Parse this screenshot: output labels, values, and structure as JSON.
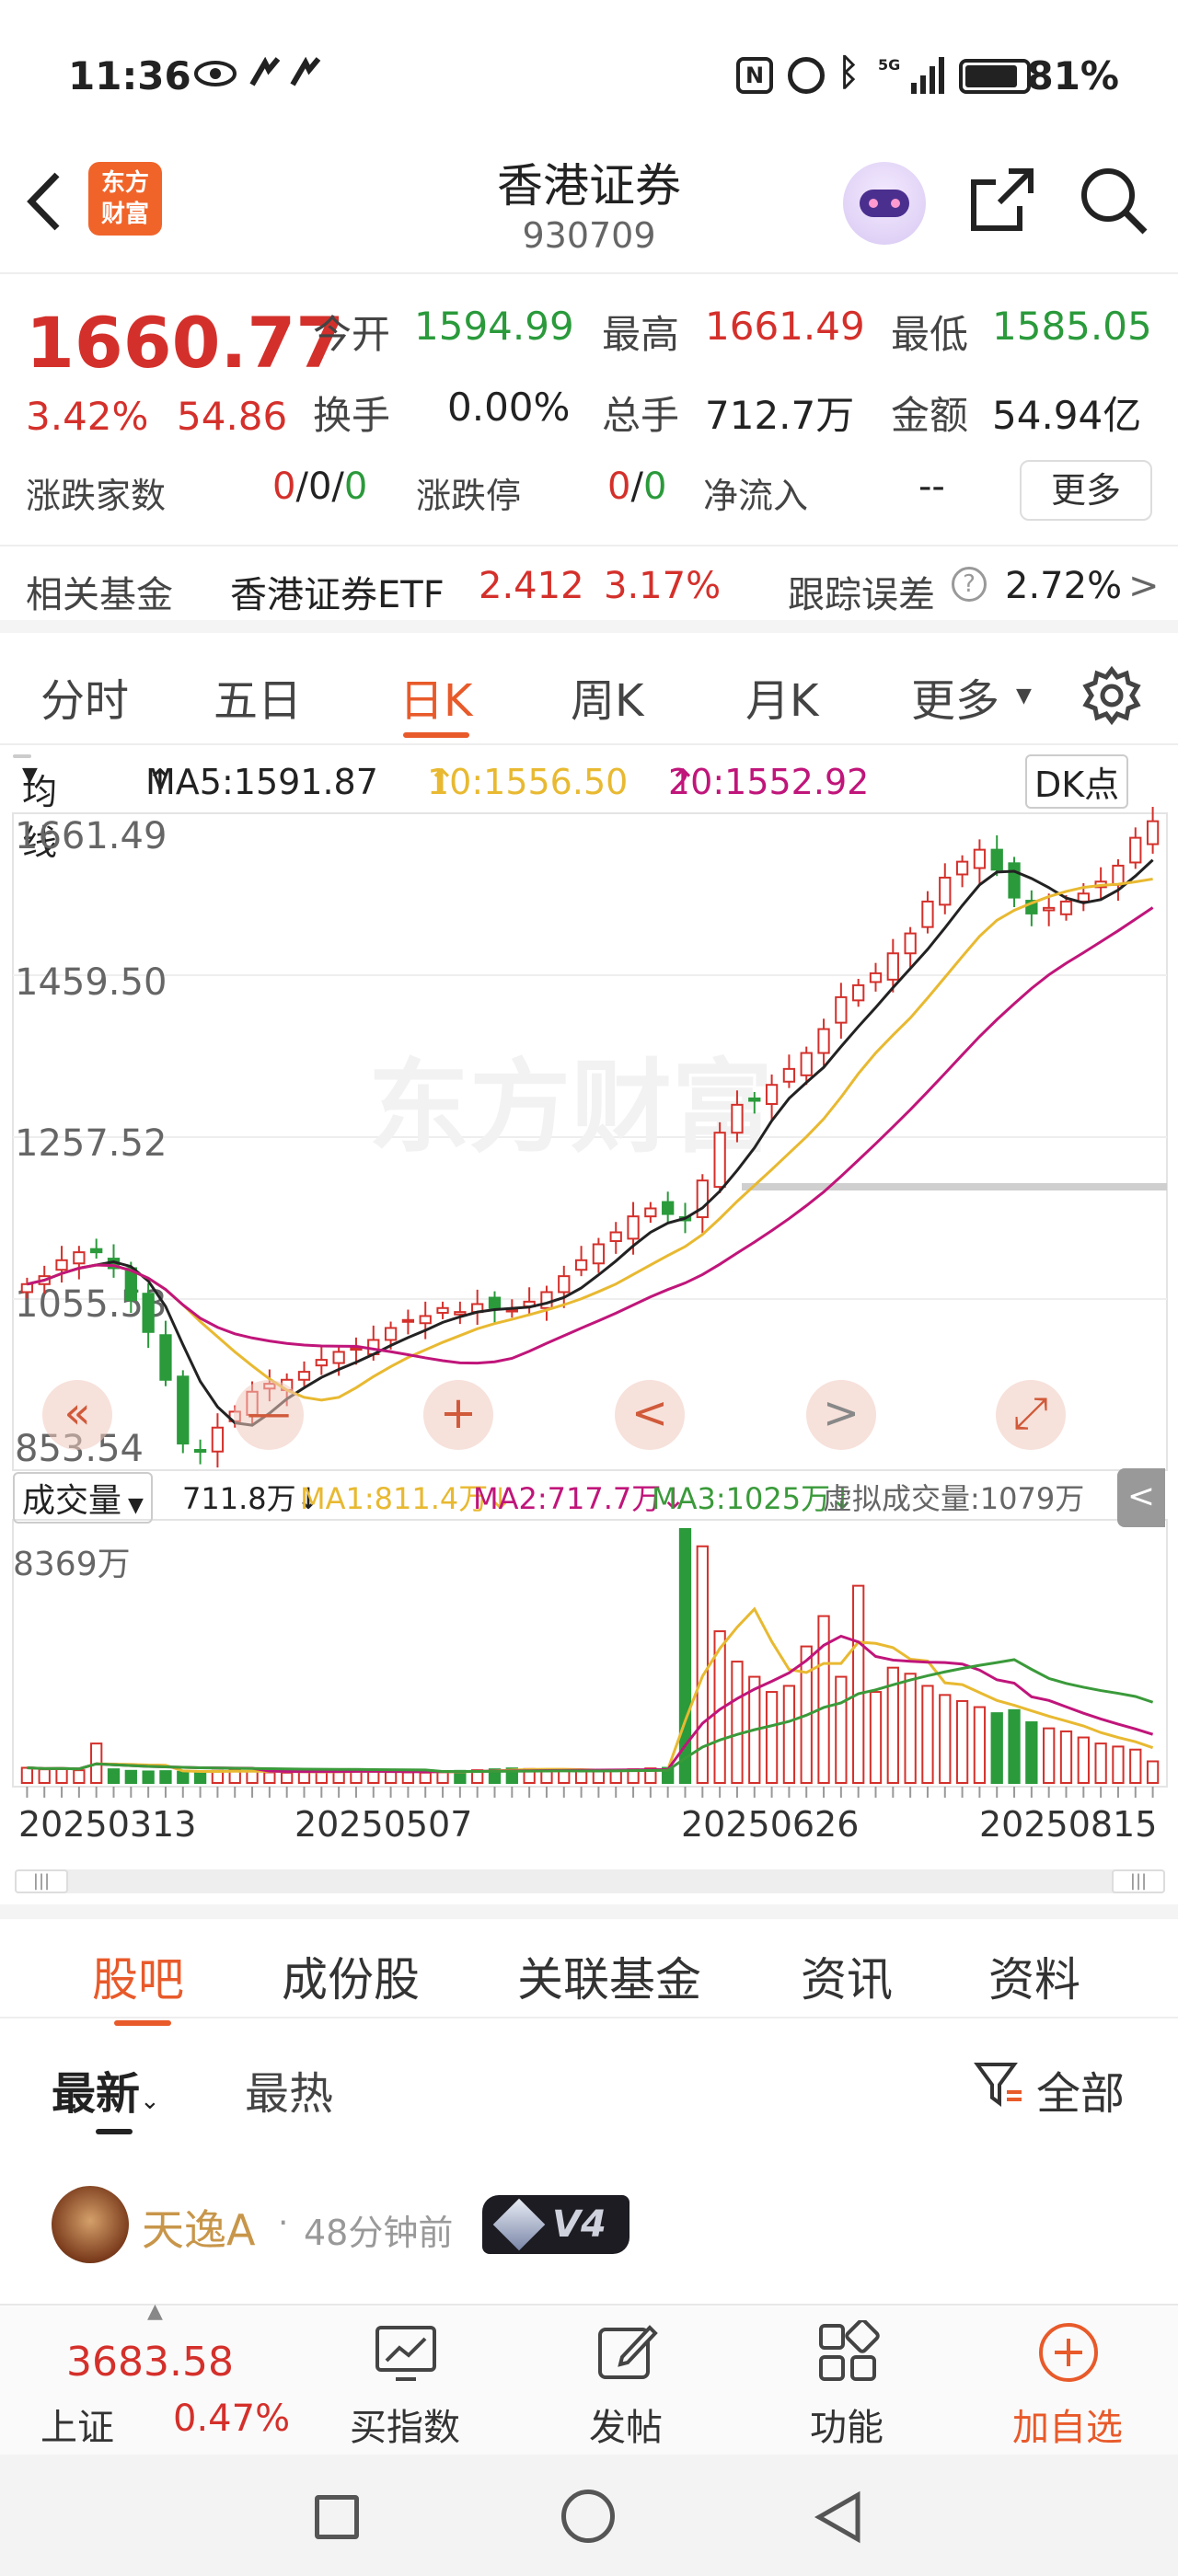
{
  "status_bar": {
    "time": "11:36",
    "battery": "81%",
    "network": "5G"
  },
  "header": {
    "logo_text_line1": "东方",
    "logo_text_line2": "财富",
    "title": "香港证券",
    "code": "930709"
  },
  "quote": {
    "price": "1660.77",
    "change_pct": "3.42%",
    "change_amt": "54.86",
    "open_label": "今开",
    "open": "1594.99",
    "high_label": "最高",
    "high": "1661.49",
    "low_label": "最低",
    "low": "1585.05",
    "turnover_label": "换手",
    "turnover": "0.00%",
    "volume_label": "总手",
    "volume": "712.7万",
    "amount_label": "金额",
    "amount": "54.94亿",
    "advdec_label": "涨跌家数",
    "advdec": [
      "0",
      "/",
      "0",
      "/",
      "0"
    ],
    "limit_label": "涨跌停",
    "limit": [
      "0",
      "/",
      "0"
    ],
    "netflow_label": "净流入",
    "netflow": "--",
    "more_button": "更多"
  },
  "fund_row": {
    "label": "相关基金",
    "fund_name": "香港证券ETF",
    "fund_price": "2.412",
    "fund_pct": "3.17%",
    "tracking_label": "跟踪误差",
    "tracking_value": "2.72%",
    "arrow": ">"
  },
  "period_tabs": [
    "分时",
    "五日",
    "日K",
    "周K",
    "月K",
    "更多"
  ],
  "active_period": 2,
  "ma_line": {
    "selector": "均线",
    "ma5": "MA5:1591.87",
    "ma10": "10:1556.50",
    "ma20": "20:1552.92",
    "dk_button": "DK点",
    "up_arrow": "↑"
  },
  "volume_line": {
    "selector": "成交量",
    "vol": "711.8万",
    "ma1": "MA1:811.4万",
    "ma2": "MA2:717.7万",
    "ma3": "MA3:1025万",
    "virtual": "虚拟成交量:1079万",
    "down_arrow": "↓"
  },
  "colors": {
    "up": "#d4302b",
    "down": "#2a9a3b",
    "ma5": "#222222",
    "ma10": "#e8b931",
    "ma20": "#c0157a",
    "ma3": "#3a9a3a",
    "accent": "#e85a2a"
  },
  "chart_data": {
    "type": "candlestick",
    "price_axis_labels": [
      "1661.49",
      "1459.50",
      "1257.52",
      "1055.53",
      "853.54"
    ],
    "price_axis_values": [
      1661.49,
      1459.5,
      1257.52,
      1055.53,
      853.54
    ],
    "ylim": [
      853.54,
      1661.49
    ],
    "date_labels": [
      "20250313",
      "20250507",
      "20250626",
      "20250815"
    ],
    "watermark": "东方财富",
    "volume_axis_label": "8369万",
    "volume_max": 8369,
    "close_approx": [
      1080,
      1090,
      1110,
      1120,
      1120,
      1100,
      1060,
      1020,
      960,
      880,
      870,
      900,
      920,
      945,
      955,
      960,
      970,
      985,
      995,
      1000,
      1010,
      1025,
      1035,
      1040,
      1050,
      1045,
      1055,
      1050,
      1048,
      1058,
      1070,
      1090,
      1110,
      1130,
      1145,
      1165,
      1175,
      1168,
      1160,
      1210,
      1270,
      1305,
      1310,
      1330,
      1350,
      1370,
      1400,
      1440,
      1455,
      1470,
      1495,
      1520,
      1560,
      1590,
      1610,
      1625,
      1600,
      1565,
      1545,
      1552,
      1560,
      1570,
      1585,
      1605,
      1640,
      1660.77
    ],
    "volume_approx_wan": [
      500,
      450,
      480,
      420,
      1300,
      450,
      400,
      380,
      390,
      370,
      360,
      400,
      420,
      380,
      350,
      340,
      360,
      380,
      400,
      420,
      380,
      360,
      350,
      340,
      380,
      400,
      420,
      450,
      480,
      460,
      440,
      420,
      400,
      380,
      420,
      450,
      480,
      500,
      8369,
      7800,
      5000,
      4000,
      3500,
      3000,
      3200,
      4500,
      5500,
      3500,
      6500,
      3000,
      3800,
      3600,
      3200,
      2900,
      2700,
      2500,
      2300,
      2400,
      2000,
      1800,
      1700,
      1500,
      1300,
      1200,
      1100,
      712.7
    ]
  },
  "chart_controls": {
    "zoom_out": "—",
    "zoom_in": "+",
    "prev": "<",
    "next": ">",
    "expand": "⤢",
    "fast_back": "«",
    "side_collapse": "<"
  },
  "content_tabs": [
    "股吧",
    "成份股",
    "关联基金",
    "资讯",
    "资料"
  ],
  "active_content_tab": 0,
  "feed": {
    "sort_latest": "最新",
    "sort_hot": "最热",
    "filter_label": "全部",
    "post_author": "天逸A",
    "post_time": "48分钟前",
    "post_badge": "V4"
  },
  "bottom_bar": {
    "index_value": "3683.58",
    "index_name": "上证",
    "index_pct": "0.47%",
    "items": [
      "买指数",
      "发帖",
      "功能",
      "加自选"
    ]
  }
}
